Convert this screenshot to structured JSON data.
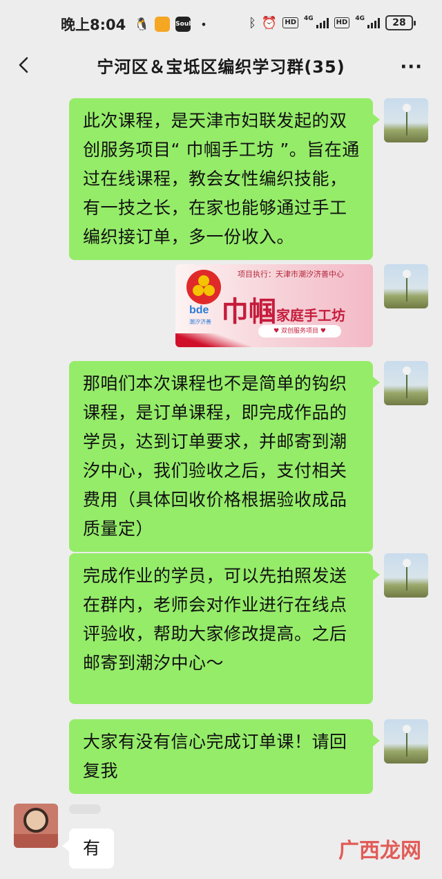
{
  "status_bar": {
    "time": "晚上8:04",
    "apps": [
      {
        "name": "penguin-icon",
        "label": "",
        "color": "#222222"
      },
      {
        "name": "orange-app-icon",
        "label": "",
        "color": "#f5a623"
      },
      {
        "name": "soul-app-icon",
        "label": "Soul",
        "color": "#222222"
      }
    ],
    "network_1": "4G",
    "network_2": "4G",
    "battery": "28"
  },
  "header": {
    "title": "宁河区＆宝坻区编织学习群(35)"
  },
  "messages": [
    {
      "side": "right",
      "type": "text",
      "text": "此次课程，是天津市妇联发起的双创服务项目“ 巾帼手工坊 ”。旨在通过在线课程，教会女性编织技能，有一技之长，在家也能够通过手工编织接订单，多一份收入。"
    },
    {
      "side": "right",
      "type": "image",
      "image": {
        "banner": "项目执行：天津市潮汐济善中心",
        "brand": "bde",
        "brand_sub": "潮汐济善",
        "big_text": "巾帼",
        "mid_text": "家庭手工坊",
        "pill": "♥ 双创服务项目 ♥"
      }
    },
    {
      "side": "right",
      "type": "text",
      "text": "那咱们本次课程也不是简单的钩织课程，是订单课程，即完成作品的学员，达到订单要求，并邮寄到潮汐中心，我们验收之后，支付相关费用（具体回收价格根据验收成品质量定）"
    },
    {
      "side": "right",
      "type": "text",
      "text": "完成作业的学员，可以先拍照发送在群内，老师会对作业进行在线点评验收，帮助大家修改提高。之后邮寄到潮汐中心～"
    },
    {
      "side": "right",
      "type": "text",
      "text": "大家有没有信心完成订单课！请回复我"
    },
    {
      "side": "left",
      "type": "text",
      "text": "有"
    }
  ],
  "watermark": "广西龙网",
  "colors": {
    "bubble_self": "#95ec69",
    "bubble_other": "#ffffff",
    "background": "#ededed"
  }
}
